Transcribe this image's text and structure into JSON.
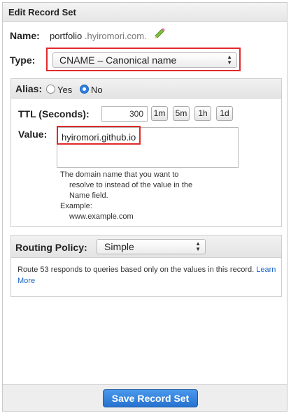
{
  "panel": {
    "title": "Edit Record Set"
  },
  "name": {
    "label": "Name:",
    "value": "portfolio",
    "suffix": ".hyiromori.com.",
    "edit_icon": "pencil-icon"
  },
  "type": {
    "label": "Type:",
    "selected": "CNAME – Canonical name"
  },
  "alias": {
    "label": "Alias:",
    "yes": "Yes",
    "no": "No",
    "selected": "No"
  },
  "ttl": {
    "label": "TTL (Seconds):",
    "value": "300",
    "presets": [
      "1m",
      "5m",
      "1h",
      "1d"
    ]
  },
  "value": {
    "label": "Value:",
    "text": "hyiromori.github.io",
    "help_line1": "The domain name that you want to",
    "help_line2": "resolve to instead of the value in the",
    "help_line3": "Name field.",
    "help_example_label": "Example:",
    "help_example": "www.example.com"
  },
  "routing": {
    "label": "Routing Policy:",
    "selected": "Simple",
    "description": "Route 53 responds to queries based only on the values in this record.",
    "learn_more": "Learn More"
  },
  "footer": {
    "save_label": "Save Record Set"
  },
  "colors": {
    "highlight": "#e02a2a",
    "primary": "#2672cf",
    "link": "#1a66c9"
  }
}
